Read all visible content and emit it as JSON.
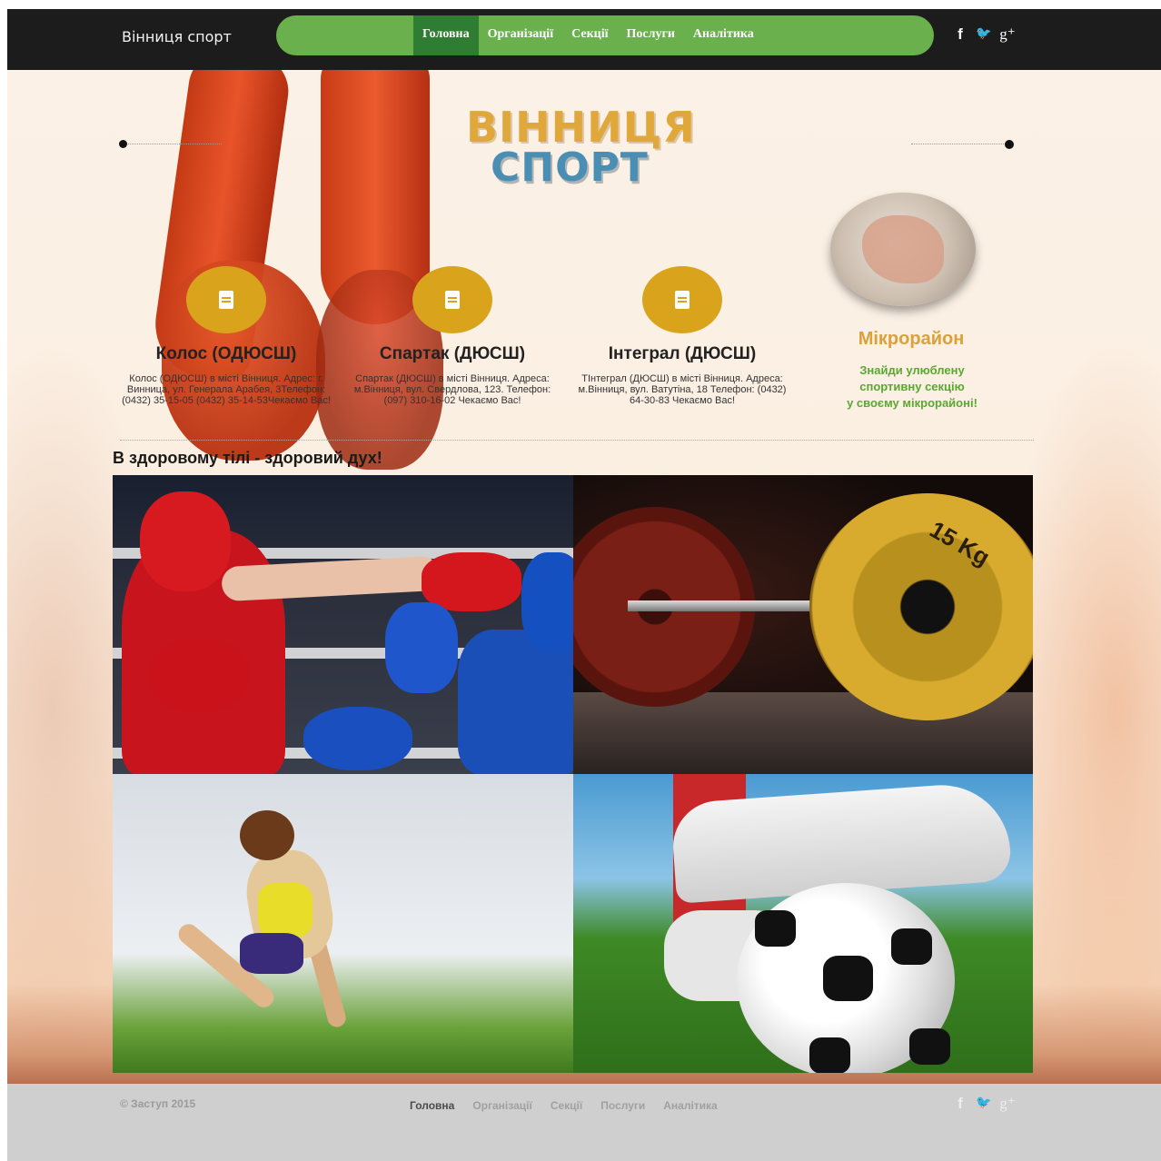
{
  "header": {
    "brand": "Вінниця спорт",
    "nav": [
      "Головна",
      "Організації",
      "Секції",
      "Послуги",
      "Аналітика"
    ],
    "social_icons": [
      "facebook-icon",
      "twitter-icon",
      "google-plus-icon"
    ],
    "social_glyphs": [
      "f",
      "🐦",
      "g⁺"
    ]
  },
  "hero": {
    "logo_line1": "ВІННИЦЯ",
    "logo_line2": "СПОРТ"
  },
  "cards": [
    {
      "title": "Колос (ОДЮСШ)",
      "text": "Колос (ОДЮСШ) в місті Вінниця. Адрес: г. Винница, ул. Генерала Арабея, 3Телефон: (0432) 35-15-05 (0432) 35-14-53Чекаємо Вас!"
    },
    {
      "title": "Спартак (ДЮСШ)",
      "text": "Спартак (ДЮСШ) в місті Вінниця. Адреса: м.Вінниця, вул. Свердлова, 123. Телефон: (097) 310-16-02 Чекаємо Вас!"
    },
    {
      "title": "Інтеграл (ДЮСШ)",
      "text": "ТІнтеграл (ДЮСШ) в місті Вінниця. Адреса: м.Вінниця, вул. Ватутіна, 18 Телефон: (0432) 64-30-83 Чекаємо Вас!"
    }
  ],
  "micro": {
    "title": "Мікрорайон",
    "line1": "Знайди улюблену",
    "line2": "спортивну секцію",
    "line3": "у своєму мікрорайоні!"
  },
  "slogan": "В здоровому тілі - здоровий дух!",
  "photos": [
    "boxing-photo",
    "barbell-photo",
    "running-photo",
    "football-photo"
  ],
  "barbell_plate_text": "15 Kg",
  "footer": {
    "copyright": "© Заступ 2015",
    "nav": [
      "Головна",
      "Організації",
      "Секції",
      "Послуги",
      "Аналітика"
    ]
  },
  "colors": {
    "nav_green": "#6ab04c",
    "nav_active": "#2e7d32",
    "card_circle": "#d9a41c",
    "micro_title": "#d9a23a",
    "micro_text": "#5aa832"
  }
}
